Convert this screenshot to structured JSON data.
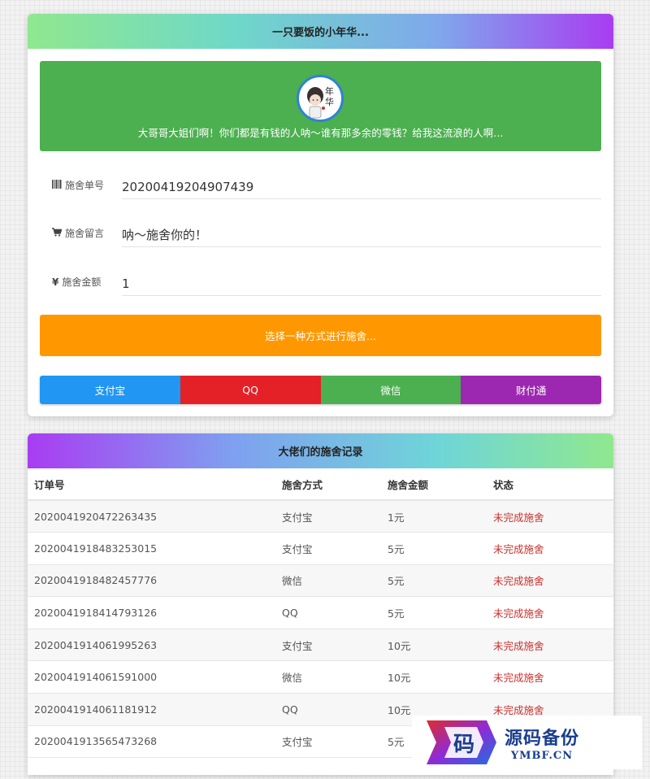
{
  "donate_card": {
    "title": "一只要饭的小年华...",
    "banner": {
      "avatar_text": "年华",
      "message": "大哥哥大姐们啊！你们都是有钱的人呐～谁有那多余的零钱？给我这流浪的人啊..."
    },
    "fields": {
      "order_no": {
        "label": "施舍单号",
        "value": "20200419204907439"
      },
      "message": {
        "label": "施舍留言",
        "value": "呐～施舍你的！"
      },
      "amount": {
        "label": "施舍金额",
        "value": "1"
      }
    },
    "choose_label": "选择一种方式进行施舍...",
    "pay_methods": [
      {
        "label": "支付宝",
        "color": "#2196f3"
      },
      {
        "label": "QQ",
        "color": "#e32127"
      },
      {
        "label": "微信",
        "color": "#4caf50"
      },
      {
        "label": "财付通",
        "color": "#9c27b0"
      }
    ]
  },
  "records": {
    "title": "大佬们的施舍记录",
    "columns": [
      "订单号",
      "施舍方式",
      "施舍金额",
      "状态"
    ],
    "rows": [
      [
        "2020041920472263435",
        "支付宝",
        "1元",
        "未完成施舍"
      ],
      [
        "2020041918483253015",
        "支付宝",
        "5元",
        "未完成施舍"
      ],
      [
        "2020041918482457776",
        "微信",
        "5元",
        "未完成施舍"
      ],
      [
        "2020041918414793126",
        "QQ",
        "5元",
        "未完成施舍"
      ],
      [
        "2020041914061995263",
        "支付宝",
        "10元",
        "未完成施舍"
      ],
      [
        "2020041914061591000",
        "微信",
        "10元",
        "未完成施舍"
      ],
      [
        "2020041914061181912",
        "QQ",
        "10元",
        "未完成施舍"
      ],
      [
        "2020041913565473268",
        "支付宝",
        "5元",
        ""
      ]
    ]
  },
  "watermark": {
    "glyph": "码",
    "cn": "源码备份",
    "en": "YMBF.CN"
  }
}
